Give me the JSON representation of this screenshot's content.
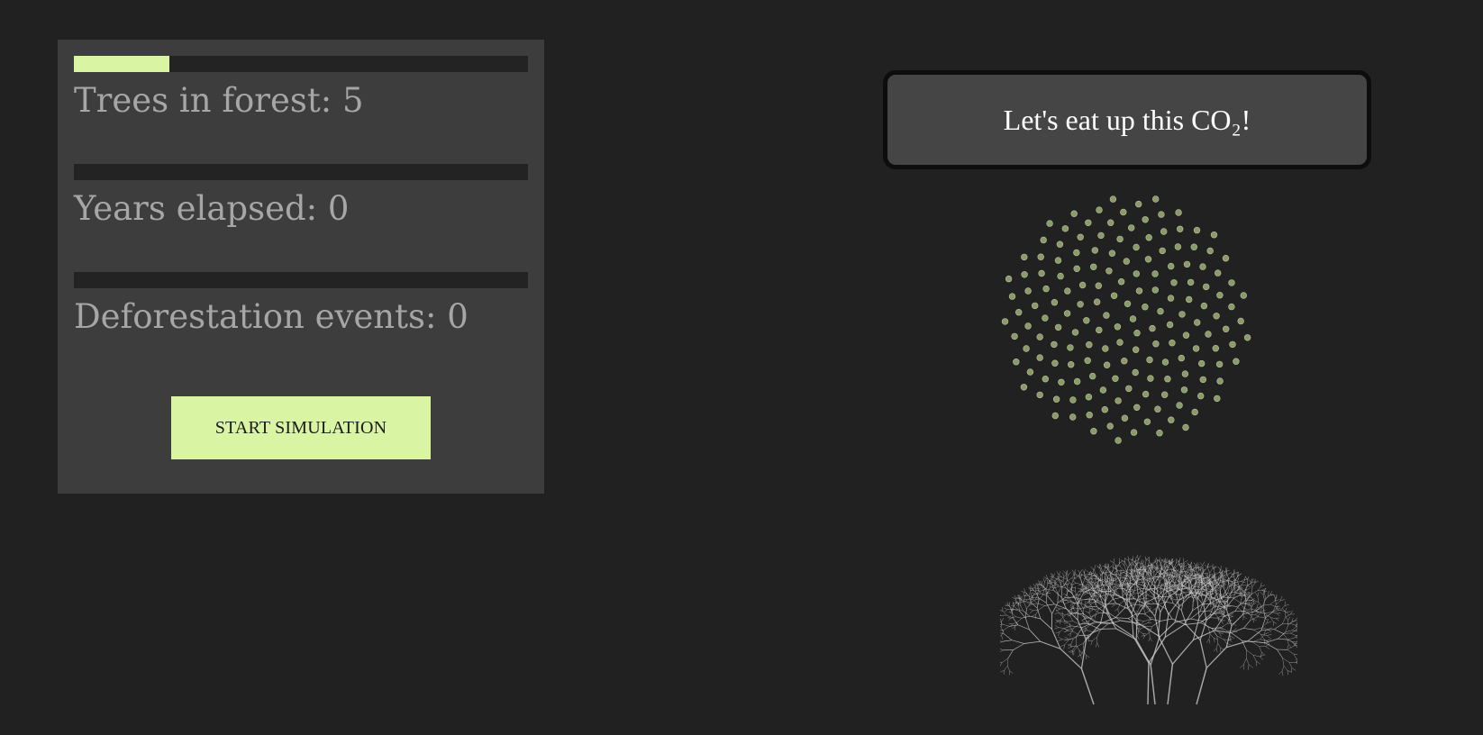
{
  "stats": {
    "trees": {
      "label": "Trees in forest: ",
      "value": "5",
      "progress": 0.21
    },
    "years": {
      "label": "Years elapsed: ",
      "value": "0",
      "progress": 0
    },
    "deforestation": {
      "label": "Deforestation events: ",
      "value": "0",
      "progress": 0
    }
  },
  "controls": {
    "start_label": "START SIMULATION"
  },
  "speech": {
    "text_pre": "Let's eat up this CO",
    "text_sub": "₂",
    "text_post": "!"
  },
  "colors": {
    "background": "#212121",
    "panel": "#3d3d3d",
    "accent": "#d9f5a3",
    "co2_dot": "#8a9a6a",
    "tree_stroke": "#d8d8d8"
  },
  "icons": {
    "co2_cloud": "co2-particle-cloud-icon",
    "forest": "tree-canopy-icon"
  }
}
